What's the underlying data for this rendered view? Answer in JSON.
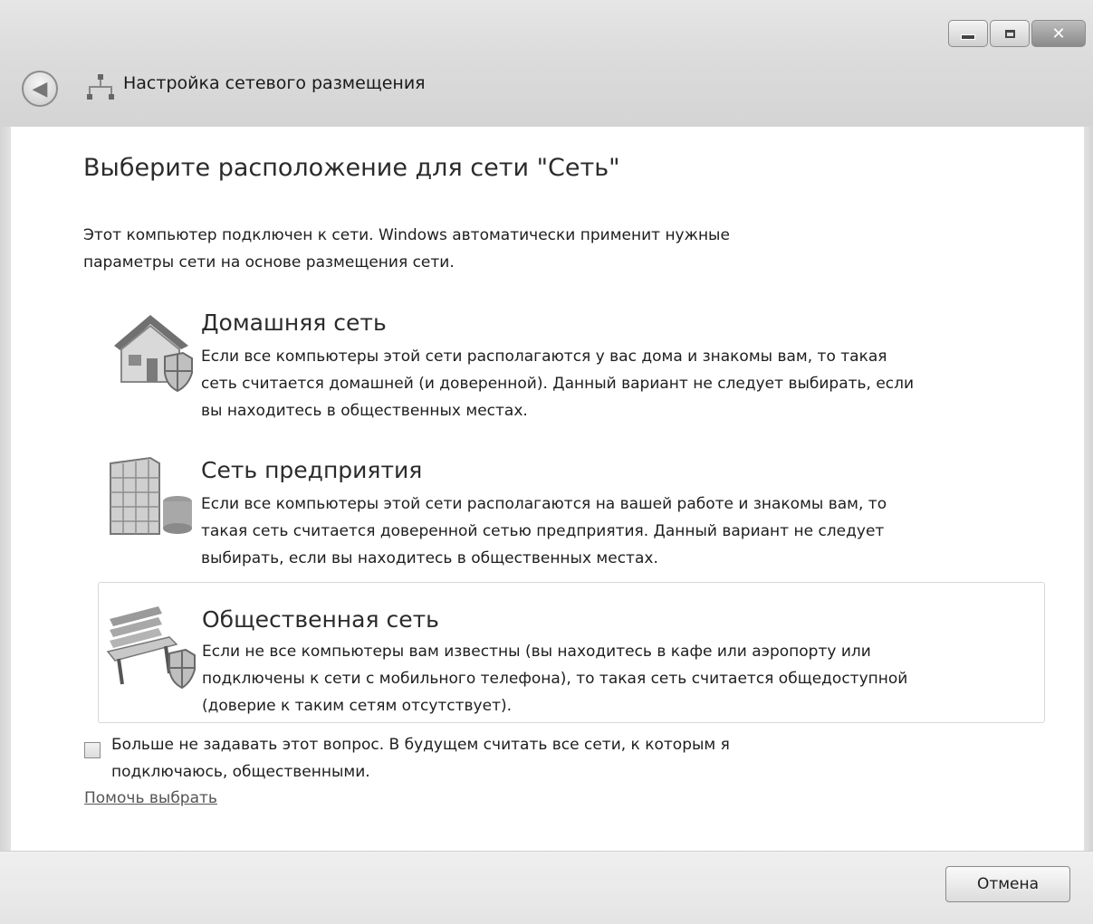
{
  "window": {
    "title": "Настройка сетевого размещения",
    "controls": {
      "minimize_icon": "minimize-icon",
      "maximize_icon": "maximize-icon",
      "close_icon": "close-icon",
      "close_glyph": "✕"
    },
    "back_glyph": "◀"
  },
  "main": {
    "heading": "Выберите расположение для сети \"Сеть\"",
    "intro_line1": "Этот компьютер подключен к сети. Windows автоматически применит нужные",
    "intro_line2": "параметры сети на основе размещения сети.",
    "options": [
      {
        "icon": "home-network-icon",
        "title": "Домашняя сеть",
        "desc_lines": [
          "Если все компьютеры этой сети располагаются у вас дома и знакомы вам, то такая",
          "сеть считается домашней (и доверенной). Данный вариант не следует выбирать, если",
          "вы находитесь в общественных местах."
        ]
      },
      {
        "icon": "work-network-icon",
        "title": "Сеть предприятия",
        "desc_lines": [
          "Если все компьютеры этой сети располагаются на вашей работе и знакомы вам, то",
          "такая сеть считается доверенной сетью предприятия. Данный вариант не следует",
          "выбирать, если вы находитесь в общественных местах."
        ]
      },
      {
        "icon": "public-network-icon",
        "title": "Общественная сеть",
        "desc_lines": [
          "Если не все компьютеры вам известны (вы находитесь в кафе или аэропорту или",
          "подключены к сети с мобильного телефона), то такая сеть считается общедоступной",
          "(доверие к таким сетям отсутствует)."
        ]
      }
    ],
    "checkbox_line1": "Больше не задавать этот вопрос. В будущем считать все сети, к которым я",
    "checkbox_line2": "подключаюсь, общественными.",
    "help_link": "Помочь выбрать"
  },
  "footer": {
    "cancel_label": "Отмена"
  }
}
